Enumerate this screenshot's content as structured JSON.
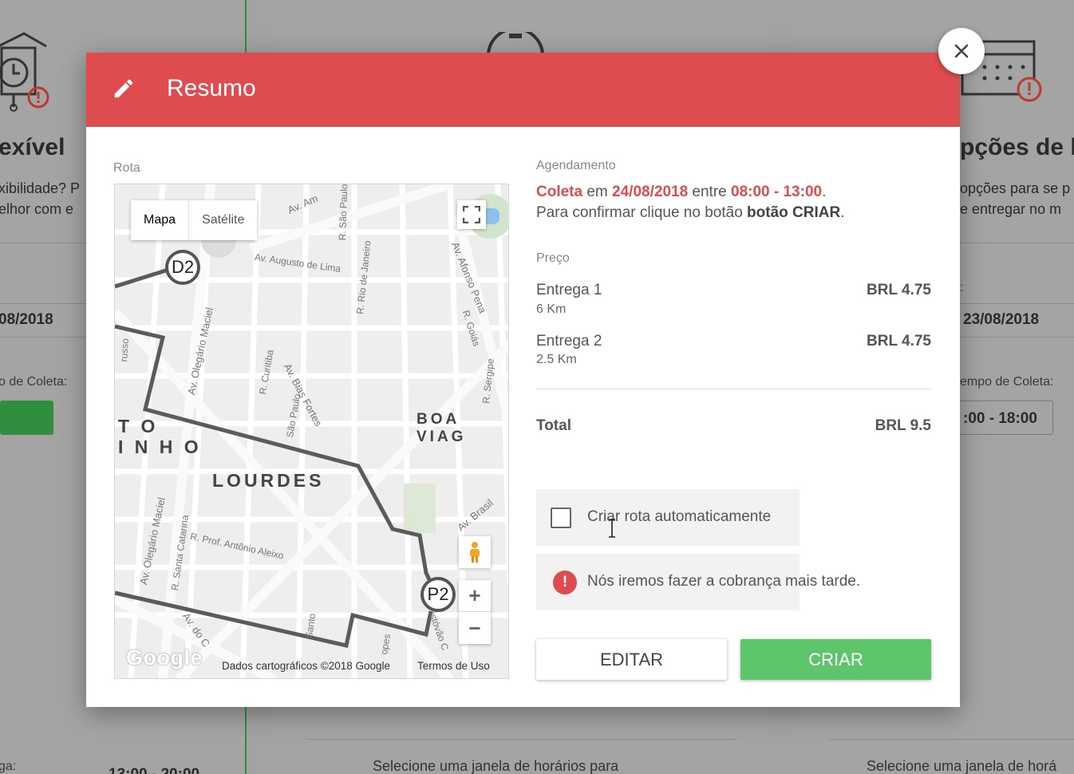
{
  "background": {
    "left_title": "exível",
    "left_sub1": "xibilidade? P",
    "left_sub2": "elhor com e",
    "left_date": "08/2018",
    "left_label": "o de Coleta:",
    "left_bottom_label": "ga:",
    "left_bottom_value": "13:00 - 20:00",
    "right_title": "pções de ho",
    "right_sub1": "opções para se p",
    "right_sub2": "e entregar no m",
    "right_colon": ":",
    "right_date": "23/08/2018",
    "right_label": "empo de Coleta:",
    "right_time": ":00 - 18:00",
    "center_bottom": "Selecione uma janela de horários para",
    "right_bottom": "Selecione uma janela de horá"
  },
  "modal": {
    "title": "Resumo",
    "header_color": "#de4c4f",
    "pencil_icon": "pencil-icon",
    "close_icon": "close-icon"
  },
  "map": {
    "label": "Rota",
    "type_map": "Mapa",
    "type_satellite": "Satélite",
    "markers": {
      "delivery": "D2",
      "pickup": "P2"
    },
    "districts": {
      "lourdes": "LOURDES",
      "boa_viagem": "BOA VIAG",
      "partial_1": "T O",
      "partial_2": "I N H O"
    },
    "streets": {
      "augusto_de_lima": "Av. Augusto de Lima",
      "olegario_maciel_1": "Av. Olegário Maciel",
      "olegario_maciel_2": "Av. Olegário Maciel",
      "bias_fortes": "Av. Bias Fortes",
      "afonso_pena": "Av. Afonso Pena",
      "brasil": "Av. Brasil",
      "curitiba": "R. Curitiba",
      "rio_de_janeiro": "R. Rio de Janeiro",
      "sao_paulo_1": "R. São Paulo",
      "sao_paulo_2": "São Paulo",
      "goias": "R. Goiás",
      "sergipe": "R. Sergipe",
      "santa_catarina": "R. Santa Catarina",
      "prof_antonio_aleixo": "R. Prof. Antônio Aleixo",
      "av_top": "Av. Am",
      "santo": "Santo",
      "do_c": "Av. do C",
      "ussu": "russo",
      "istovao": "istóvão C",
      "opes": "opes"
    },
    "logo": "Google",
    "attribution": "Dados cartográficos ©2018 Google",
    "terms": "Termos de Uso",
    "zoom_in": "+",
    "zoom_out": "−",
    "route_color": "#5b5b5b"
  },
  "schedule": {
    "label": "Agendamento",
    "type": "Coleta",
    "word_em": "em",
    "date": "24/08/2018",
    "word_entre": "entre",
    "time": "08:00 - 13:00",
    "period": ".",
    "confirm_prefix": "Para confirmar clique no botão",
    "confirm_button": "botão CRIAR",
    "confirm_suffix": "."
  },
  "price": {
    "label": "Preço",
    "items": [
      {
        "name": "Entrega 1",
        "distance": "6 Km",
        "value": "BRL 4.75"
      },
      {
        "name": "Entrega 2",
        "distance": "2.5 Km",
        "value": "BRL 4.75"
      }
    ],
    "total_label": "Total",
    "total_value": "BRL 9.5"
  },
  "options": {
    "auto_route_label": "Criar rota automaticamente",
    "auto_route_checked": false,
    "charge_notice": "Nós iremos fazer a cobrança mais tarde."
  },
  "actions": {
    "edit_label": "EDITAR",
    "create_label": "CRIAR",
    "create_color": "#5fc56c"
  }
}
